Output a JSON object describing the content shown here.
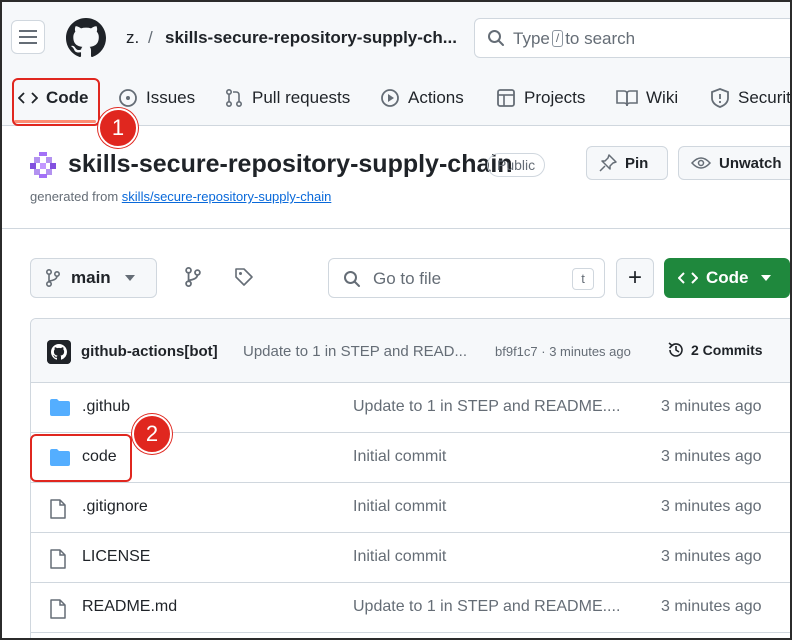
{
  "header": {
    "owner": "z.",
    "separator": "/",
    "repo_crumb": "skills-secure-repository-supply-ch...",
    "search_prefix": "Type",
    "search_key": "/",
    "search_suffix": "to search"
  },
  "nav": {
    "items": [
      {
        "label": "Code",
        "icon": "code-icon"
      },
      {
        "label": "Issues",
        "icon": "issue-icon"
      },
      {
        "label": "Pull requests",
        "icon": "pull-request-icon"
      },
      {
        "label": "Actions",
        "icon": "play-icon"
      },
      {
        "label": "Projects",
        "icon": "table-icon"
      },
      {
        "label": "Wiki",
        "icon": "book-icon"
      },
      {
        "label": "Securit",
        "icon": "shield-icon"
      }
    ]
  },
  "callouts": {
    "step1": "1",
    "step2": "2"
  },
  "repo": {
    "title": "skills-secure-repository-supply-chain",
    "visibility": "Public",
    "generated_from_label": "generated from",
    "generated_from_link": "skills/secure-repository-supply-chain",
    "pin_label": "Pin",
    "unwatch_label": "Unwatch"
  },
  "toolbar": {
    "branch": "main",
    "go_to_file_placeholder": "Go to file",
    "go_to_file_key": "t",
    "add_label": "+",
    "code_button_label": "Code"
  },
  "latest_commit": {
    "author": "github-actions[bot]",
    "message": "Update to 1 in STEP and READ...",
    "meta": "bf9f1c7 · 3 minutes ago",
    "commits_label": "2 Commits"
  },
  "files": [
    {
      "name": ".github",
      "type": "folder",
      "message": "Update to 1 in STEP and README....",
      "time": "3 minutes ago"
    },
    {
      "name": "code",
      "type": "folder",
      "message": "Initial commit",
      "time": "3 minutes ago"
    },
    {
      "name": ".gitignore",
      "type": "file",
      "message": "Initial commit",
      "time": "3 minutes ago"
    },
    {
      "name": "LICENSE",
      "type": "file",
      "message": "Initial commit",
      "time": "3 minutes ago"
    },
    {
      "name": "README.md",
      "type": "file",
      "message": "Update to 1 in STEP and README....",
      "time": "3 minutes ago"
    }
  ],
  "colors": {
    "accent": "#1f883d",
    "callout": "#e0271f",
    "link": "#0969da",
    "folder": "#54aeff"
  }
}
